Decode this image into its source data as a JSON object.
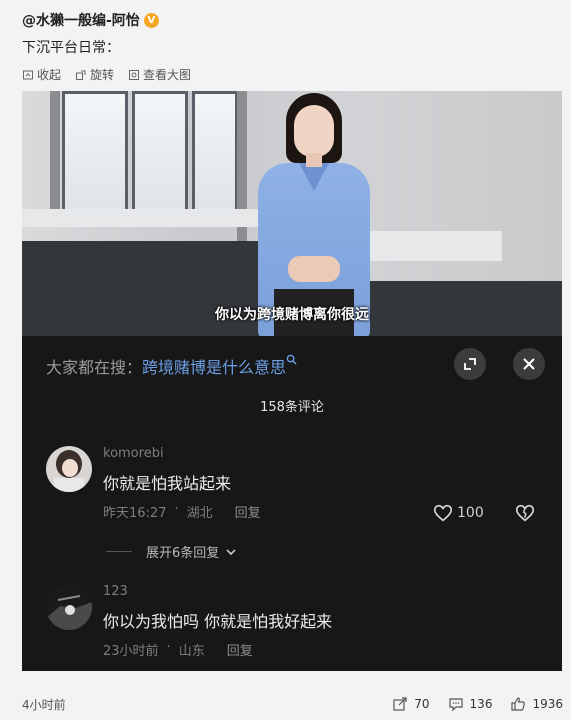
{
  "post": {
    "author": "@水獭一般编-阿怡",
    "verified_icon": "verified-badge-icon",
    "text": "下沉平台日常："
  },
  "actions": {
    "collapse": "收起",
    "rotate": "旋转",
    "view_large": "查看大图"
  },
  "screenshot": {
    "subtitle": "你以为跨境赌博离你很远",
    "search_prefix": "大家都在搜：",
    "search_term": "跨境赌博是什么意思",
    "comment_count": "158条评论",
    "comments": [
      {
        "name": "komorebi",
        "text": "你就是怕我站起来",
        "time": "昨天16:27",
        "location": "湖北",
        "reply": "回复",
        "likes": "100"
      },
      {
        "name": "123",
        "text": "你以为我怕吗 你就是怕我好起来",
        "time": "23小时前",
        "location": "山东",
        "reply": "回复"
      }
    ],
    "expand_replies": "展开6条回复"
  },
  "footer": {
    "time": "4小时前",
    "reposts": "70",
    "comments": "136",
    "likes": "1936"
  },
  "colors": {
    "search_term": "#6b9fe6",
    "verified": "#f5a623",
    "panel_bg": "#171717"
  }
}
